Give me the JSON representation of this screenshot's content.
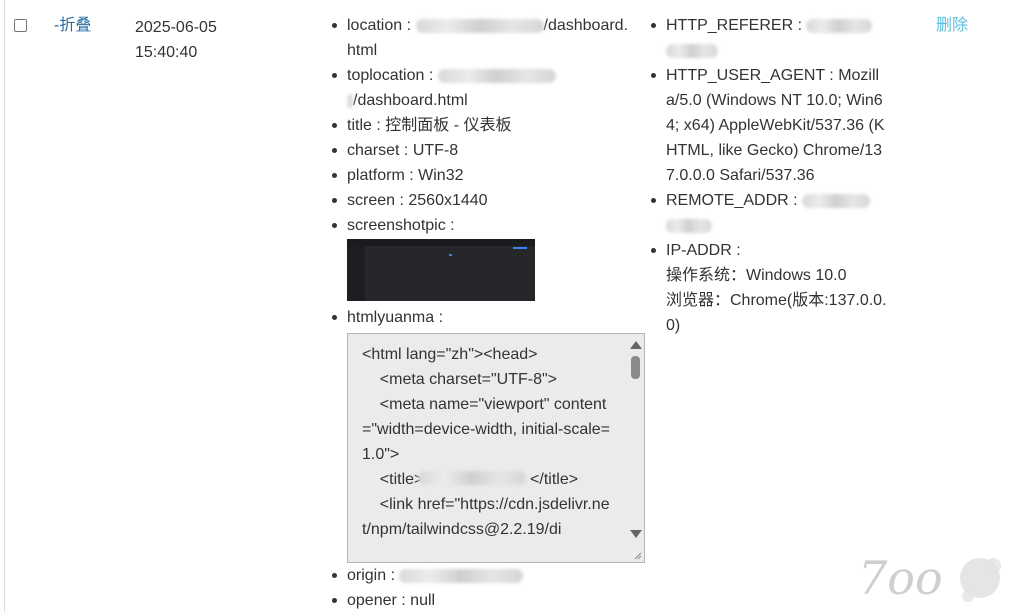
{
  "row": {
    "fold_label": "-折叠",
    "date": "2025-06-05",
    "time": "15:40:40",
    "delete_label": "删除"
  },
  "client_info": {
    "location": {
      "key": "location",
      "sep": " : ",
      "tail": "/dashboard.html"
    },
    "toplocation": {
      "key": "toplocation",
      "sep": " : ",
      "tail": "/dashboard.html"
    },
    "title": {
      "key": "title",
      "sep": " : ",
      "value": "控制面板 - 仪表板"
    },
    "charset": {
      "key": "charset",
      "sep": " : ",
      "value": "UTF-8"
    },
    "platform": {
      "key": "platform",
      "sep": " : ",
      "value": "Win32"
    },
    "screen": {
      "key": "screen",
      "sep": " : ",
      "value": "2560x1440"
    },
    "screenshotpic": {
      "key": "screenshotpic",
      "sep": " :"
    },
    "htmlyuanma": {
      "key": "htmlyuanma",
      "sep": " :",
      "code": "<html lang=\"zh\"><head>\n    <meta charset=\"UTF-8\">\n    <meta name=\"viewport\" content=\"width=device-width, initial-scale=1.0\">\n    <title>                        </title>\n    <link href=\"https://cdn.jsdelivr.net/npm/tailwindcss@2.2.19/di"
    },
    "origin": {
      "key": "origin",
      "sep": " : "
    },
    "opener": {
      "key": "opener",
      "sep": " : ",
      "value": "null"
    }
  },
  "server_info": {
    "http_referer": {
      "key": "HTTP_REFERER",
      "sep": " : "
    },
    "http_user_agent": {
      "key": "HTTP_USER_AGENT",
      "sep": " : ",
      "value": "Mozilla/5.0 (Windows NT 10.0; Win64; x64) AppleWebKit/537.36 (KHTML, like Gecko) Chrome/137.0.0.0 Safari/537.36"
    },
    "remote_addr": {
      "key": "REMOTE_ADDR",
      "sep": " : "
    },
    "ip_addr": {
      "key": "IP-ADDR",
      "sep": " :",
      "os_line": "操作系统：Windows 10.0",
      "browser_line": "浏览器：Chrome(版本:137.0.0.0)"
    }
  },
  "watermark": {
    "text": "7oo"
  },
  "colors": {
    "link_blue": "#2b6ea3",
    "delete_cyan": "#5bc0de",
    "code_bg": "#ebebeb",
    "text": "#333333"
  },
  "icons": {
    "scroll_up": "triangle-up-icon",
    "scroll_down": "triangle-down-icon",
    "resize": "resize-grip-icon"
  }
}
